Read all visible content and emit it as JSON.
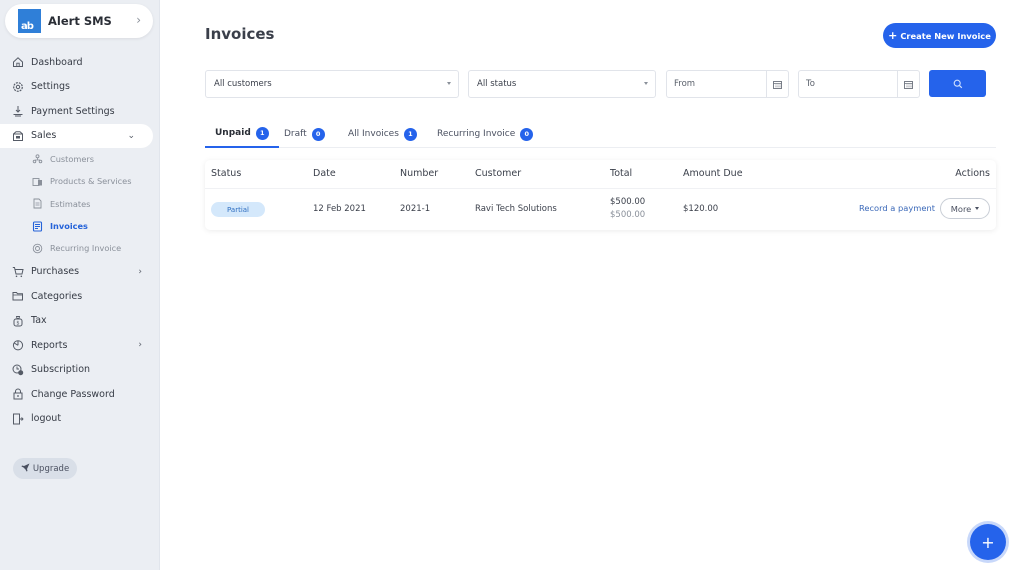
{
  "brand": {
    "logo_text": "ab",
    "name": "Alert SMS"
  },
  "sidebar": {
    "items": [
      {
        "label": "Dashboard",
        "icon": "home-icon"
      },
      {
        "label": "Settings",
        "icon": "gear-icon"
      },
      {
        "label": "Payment Settings",
        "icon": "payment-icon"
      },
      {
        "label": "Sales",
        "icon": "sales-icon",
        "expanded": true
      },
      {
        "label": "Purchases",
        "icon": "cart-icon"
      },
      {
        "label": "Categories",
        "icon": "folder-icon"
      },
      {
        "label": "Tax",
        "icon": "tax-icon"
      },
      {
        "label": "Reports",
        "icon": "reports-icon"
      },
      {
        "label": "Subscription",
        "icon": "subscription-icon"
      },
      {
        "label": "Change Password",
        "icon": "lock-icon"
      },
      {
        "label": "logout",
        "icon": "logout-icon"
      }
    ],
    "sales_sub": [
      {
        "label": "Customers",
        "icon": "customers-icon"
      },
      {
        "label": "Products & Services",
        "icon": "products-icon"
      },
      {
        "label": "Estimates",
        "icon": "estimates-icon"
      },
      {
        "label": "Invoices",
        "icon": "invoices-icon",
        "active": true
      },
      {
        "label": "Recurring Invoice",
        "icon": "recurring-icon"
      }
    ],
    "upgrade_label": "Upgrade"
  },
  "header": {
    "title": "Invoices",
    "create_button": "Create New Invoice"
  },
  "filters": {
    "customer_select": "All customers",
    "status_select": "All status",
    "from_placeholder": "From",
    "to_placeholder": "To"
  },
  "tabs": [
    {
      "label": "Unpaid",
      "count": "1",
      "active": true
    },
    {
      "label": "Draft",
      "count": "0"
    },
    {
      "label": "All Invoices",
      "count": "1"
    },
    {
      "label": "Recurring Invoice",
      "count": "0"
    }
  ],
  "table": {
    "headers": [
      "Status",
      "Date",
      "Number",
      "Customer",
      "Total",
      "Amount Due",
      "Actions"
    ],
    "rows": [
      {
        "status": "Partial",
        "date": "12 Feb 2021",
        "number": "2021-1",
        "customer": "Ravi Tech Solutions",
        "total": "$500.00",
        "total_sub": "$500.00",
        "amount_due": "$120.00",
        "record_payment": "Record a payment",
        "more": "More"
      }
    ]
  },
  "colors": {
    "accent": "#2563eb",
    "sidebar_bg": "#ebeef3",
    "status_partial_bg": "#d4e8fb"
  }
}
